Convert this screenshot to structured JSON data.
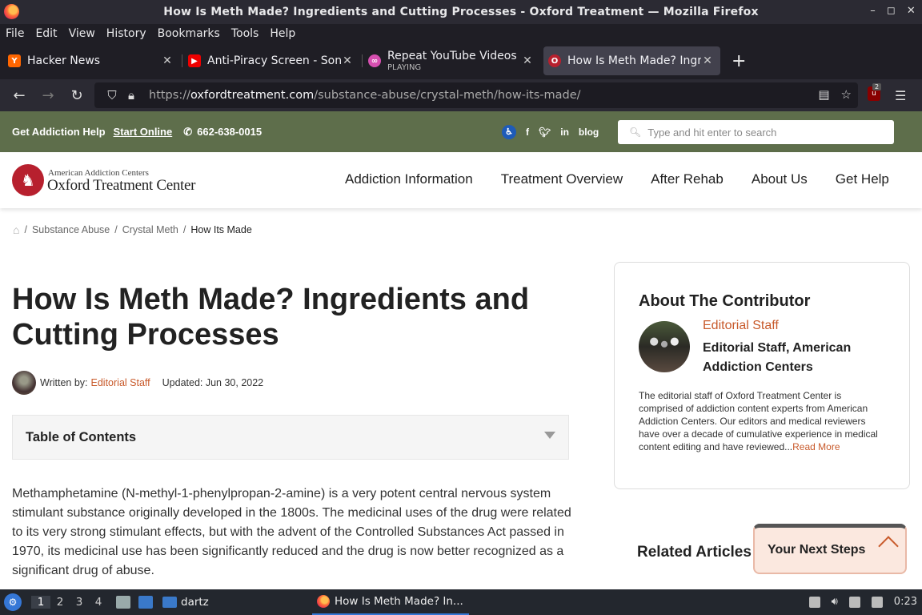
{
  "window": {
    "title": "How Is Meth Made? Ingredients and Cutting Processes - Oxford Treatment — Mozilla Firefox",
    "controls": [
      "–",
      "◻",
      "✕"
    ]
  },
  "menubar": [
    "File",
    "Edit",
    "View",
    "History",
    "Bookmarks",
    "Tools",
    "Help"
  ],
  "tabs": [
    {
      "label": "Hacker News",
      "sub": "",
      "favicon": "Y",
      "favicon_color": "#ff6600",
      "active": false
    },
    {
      "label": "Anti-Piracy Screen - Sonic",
      "sub": "",
      "favicon": "▶",
      "favicon_color": "#e00",
      "active": false
    },
    {
      "label": "Repeat YouTube Videos |",
      "sub": "PLAYING",
      "favicon": "∞",
      "favicon_color": "#d64fb0",
      "active": false
    },
    {
      "label": "How Is Meth Made? Ingre",
      "sub": "",
      "favicon": "O",
      "favicon_color": "#b7202e",
      "active": true
    }
  ],
  "new_tab_icon": "+",
  "navbar": {
    "url_prefix": "https://",
    "url_domain": "oxfordtreatment.com",
    "url_path": "/substance-abuse/crystal-meth/how-its-made/",
    "ublock_count": "2"
  },
  "site": {
    "topbar": {
      "help_text": "Get Addiction Help",
      "start_online": "Start Online",
      "phone": "662-638-0015",
      "blog": "blog",
      "search_placeholder": "Type and hit enter to search"
    },
    "logo": {
      "small": "American Addiction Centers",
      "big": "Oxford Treatment Center"
    },
    "nav": [
      "Addiction Information",
      "Treatment Overview",
      "After Rehab",
      "About Us",
      "Get Help"
    ],
    "breadcrumbs": [
      "Substance Abuse",
      "Crystal Meth",
      "How Its Made"
    ],
    "article": {
      "title": "How Is Meth Made? Ingredients and Cutting Processes",
      "written_by_label": "Written by:",
      "author": "Editorial Staff",
      "updated": "Updated: Jun 30, 2022",
      "toc_label": "Table of Contents",
      "body": "Methamphetamine (N-methyl-1-phenylpropan-2-amine) is a very potent central nervous system stimulant substance originally developed in the 1800s. The medicinal uses of the drug were related to its very strong stimulant effects, but with the advent of the Controlled Substances Act passed in 1970, its medicinal use has been significantly reduced and the drug is now better recognized as a significant drug of abuse."
    },
    "contributor": {
      "heading": "About The Contributor",
      "link": "Editorial Staff",
      "name": "Editorial Staff, American Addiction Centers",
      "description": "The editorial staff of Oxford Treatment Center is comprised of addiction content experts from American Addiction Centers. Our editors and medical reviewers have over a decade of cumulative experience in medical content editing and have reviewed...",
      "read_more": "Read More"
    },
    "related_heading": "Related Articles",
    "next_steps": "Your Next Steps"
  },
  "taskbar": {
    "workspaces": [
      "1",
      "2",
      "3",
      "4"
    ],
    "folder": "dartz",
    "task": "How Is Meth Made? In...",
    "clock": "0:23"
  }
}
